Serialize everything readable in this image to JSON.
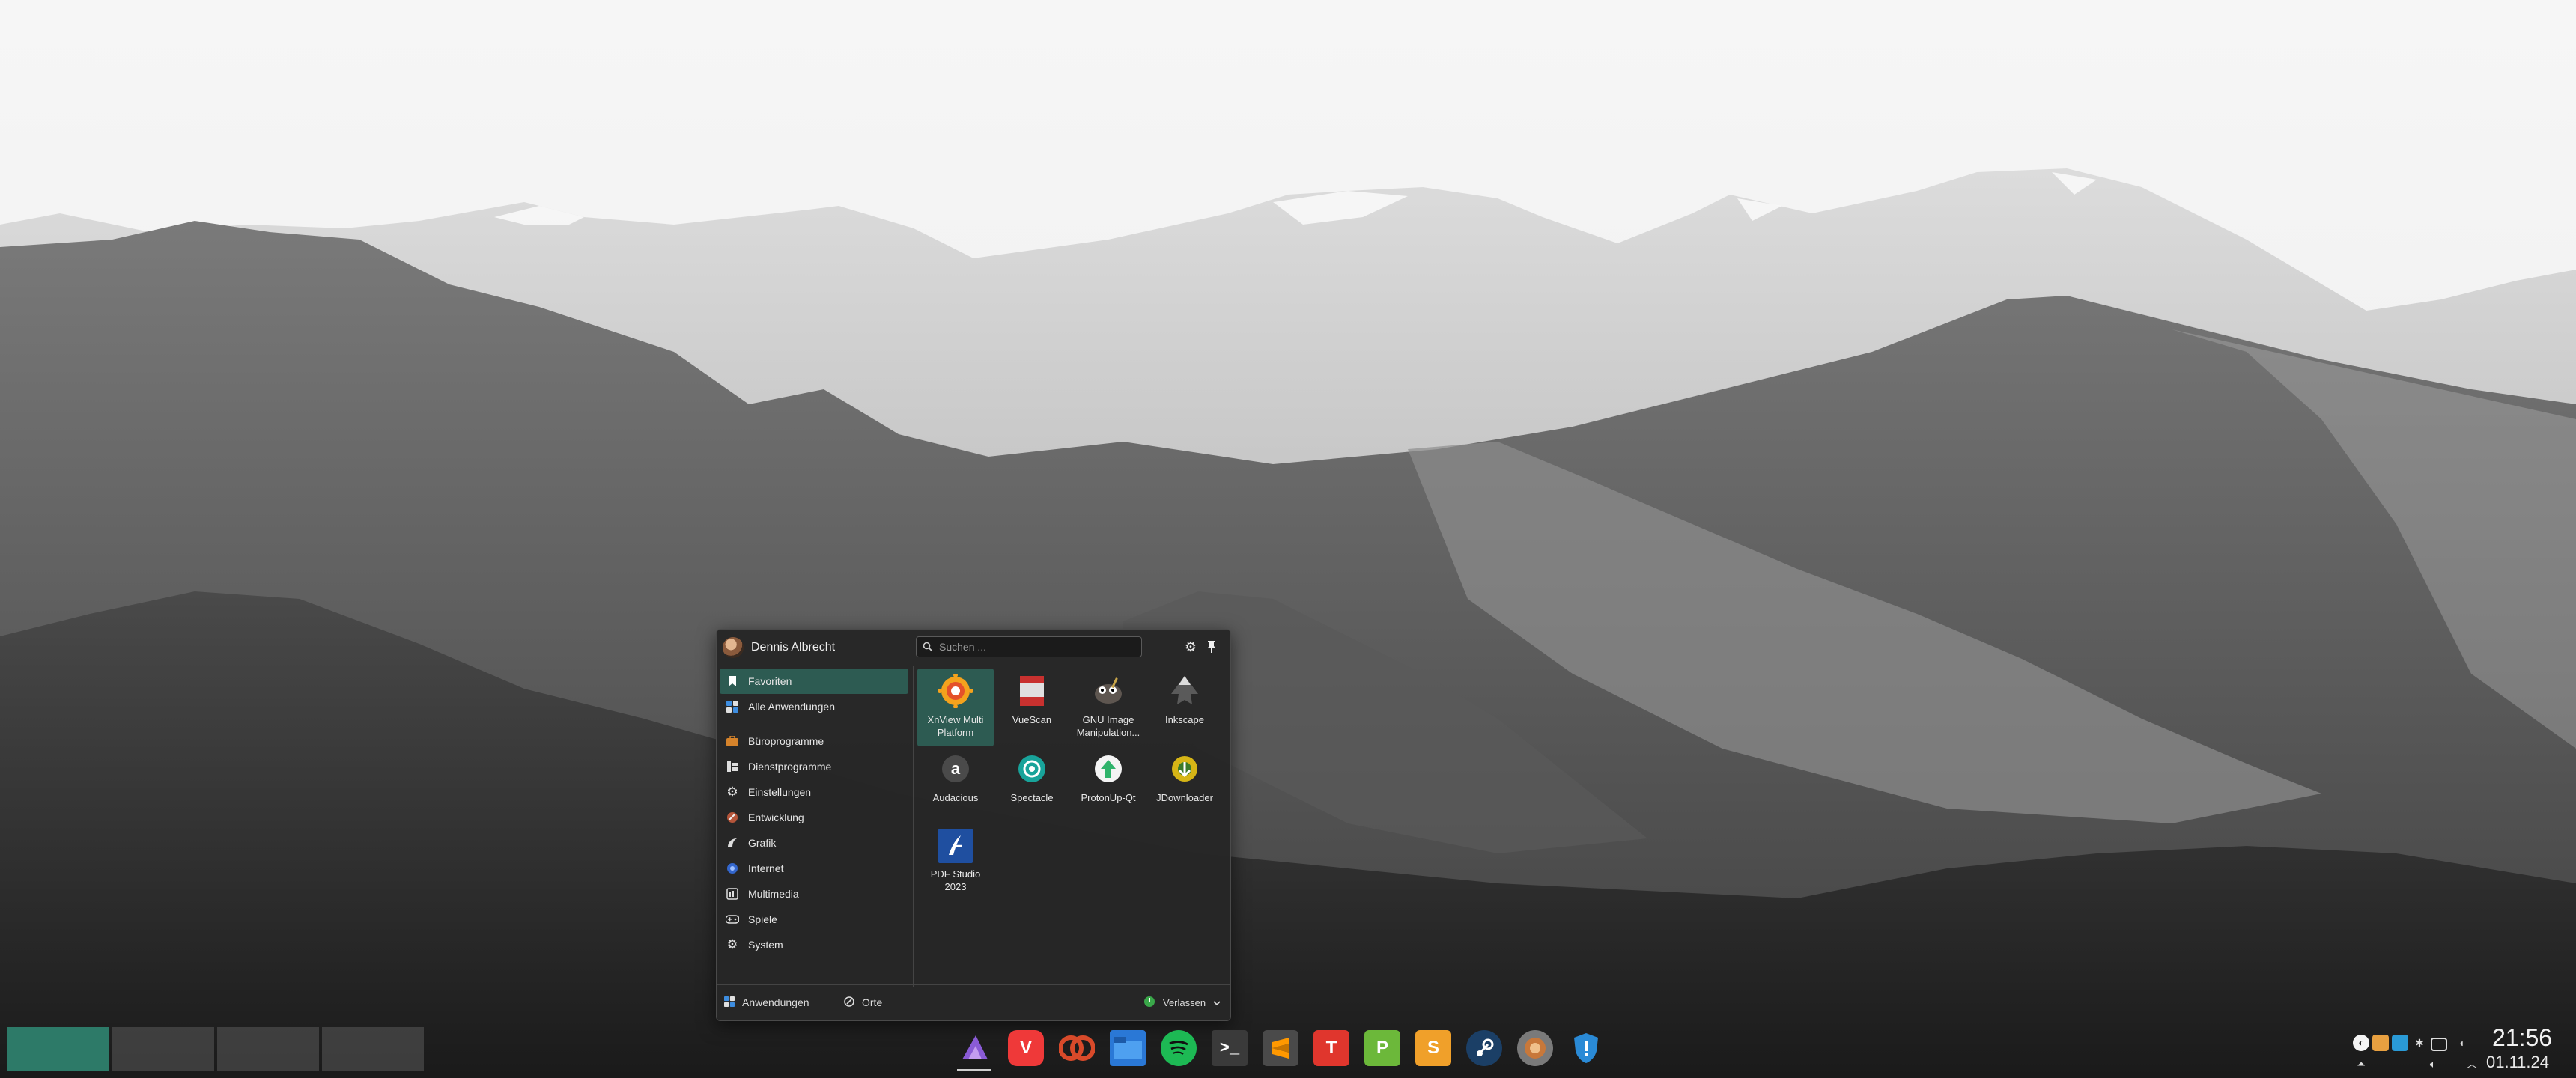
{
  "launcher": {
    "user_name": "Dennis Albrecht",
    "search_placeholder": "Suchen ...",
    "categories": [
      {
        "label": "Favoriten",
        "icon": "bookmark-icon",
        "active": true
      },
      {
        "label": "Alle Anwendungen",
        "icon": "all-apps-icon"
      },
      {
        "label": "Büroprogramme",
        "icon": "briefcase-icon"
      },
      {
        "label": "Dienstprogramme",
        "icon": "utilities-icon"
      },
      {
        "label": "Einstellungen",
        "icon": "settings-gear-icon"
      },
      {
        "label": "Entwicklung",
        "icon": "development-icon"
      },
      {
        "label": "Grafik",
        "icon": "graphics-icon"
      },
      {
        "label": "Internet",
        "icon": "globe-icon"
      },
      {
        "label": "Multimedia",
        "icon": "multimedia-icon"
      },
      {
        "label": "Spiele",
        "icon": "gamepad-icon"
      },
      {
        "label": "System",
        "icon": "system-gear-icon"
      }
    ],
    "apps": [
      {
        "label": "XnView Multi\nPlatform",
        "icon": "xnview-icon",
        "color": "#e8702a",
        "selected": true
      },
      {
        "label": "VueScan",
        "icon": "vuescan-icon",
        "color": "#c8312f"
      },
      {
        "label": "GNU Image\nManipulation...",
        "icon": "gimp-icon",
        "color": "#6a625a"
      },
      {
        "label": "Inkscape",
        "icon": "inkscape-icon",
        "color": "#555555"
      },
      {
        "label": "Audacious",
        "icon": "audacious-icon",
        "color": "#4a4a4a"
      },
      {
        "label": "Spectacle",
        "icon": "spectacle-icon",
        "color": "#18a39a"
      },
      {
        "label": "ProtonUp-Qt",
        "icon": "protonup-icon",
        "color": "#2fb36b"
      },
      {
        "label": "JDownloader",
        "icon": "jdownloader-icon",
        "color": "#d6b516"
      },
      {
        "label": "PDF Studio\n2023",
        "icon": "pdfstudio-icon",
        "color": "#1f4fa0"
      }
    ],
    "footer": {
      "applications_label": "Anwendungen",
      "places_label": "Orte",
      "leave_label": "Verlassen"
    }
  },
  "taskbar": {
    "apps": [
      {
        "name": "kde-plasma-icon",
        "color": "#8a5bd6"
      },
      {
        "name": "vivaldi-icon",
        "color": "#ef3939"
      },
      {
        "name": "davinci-resolve-icon",
        "color": "#d84a2a"
      },
      {
        "name": "file-manager-icon",
        "color": "#2a78d6"
      },
      {
        "name": "spotify-icon",
        "color": "#1db954"
      },
      {
        "name": "terminal-icon",
        "color": "#3a3a3a"
      },
      {
        "name": "sublime-text-icon",
        "color": "#4a4a4a"
      },
      {
        "name": "textmaker-icon",
        "color": "#e0362d"
      },
      {
        "name": "planmaker-icon",
        "color": "#6cb83a"
      },
      {
        "name": "presentations-icon",
        "color": "#f0a02a"
      },
      {
        "name": "steam-icon",
        "color": "#1b3f66"
      },
      {
        "name": "app-generic-icon",
        "color": "#c8783a"
      },
      {
        "name": "shield-icon",
        "color": "#2a8ad6"
      }
    ],
    "tray": [
      "tray-icon-1",
      "tray-icon-2",
      "tray-icon-3",
      "tray-icon-4",
      "tray-icon-5",
      "tray-icon-6",
      "network-icon",
      "volume-icon",
      "chevron-up-icon"
    ],
    "clock_time": "21:56",
    "clock_date": "01.11.24"
  }
}
